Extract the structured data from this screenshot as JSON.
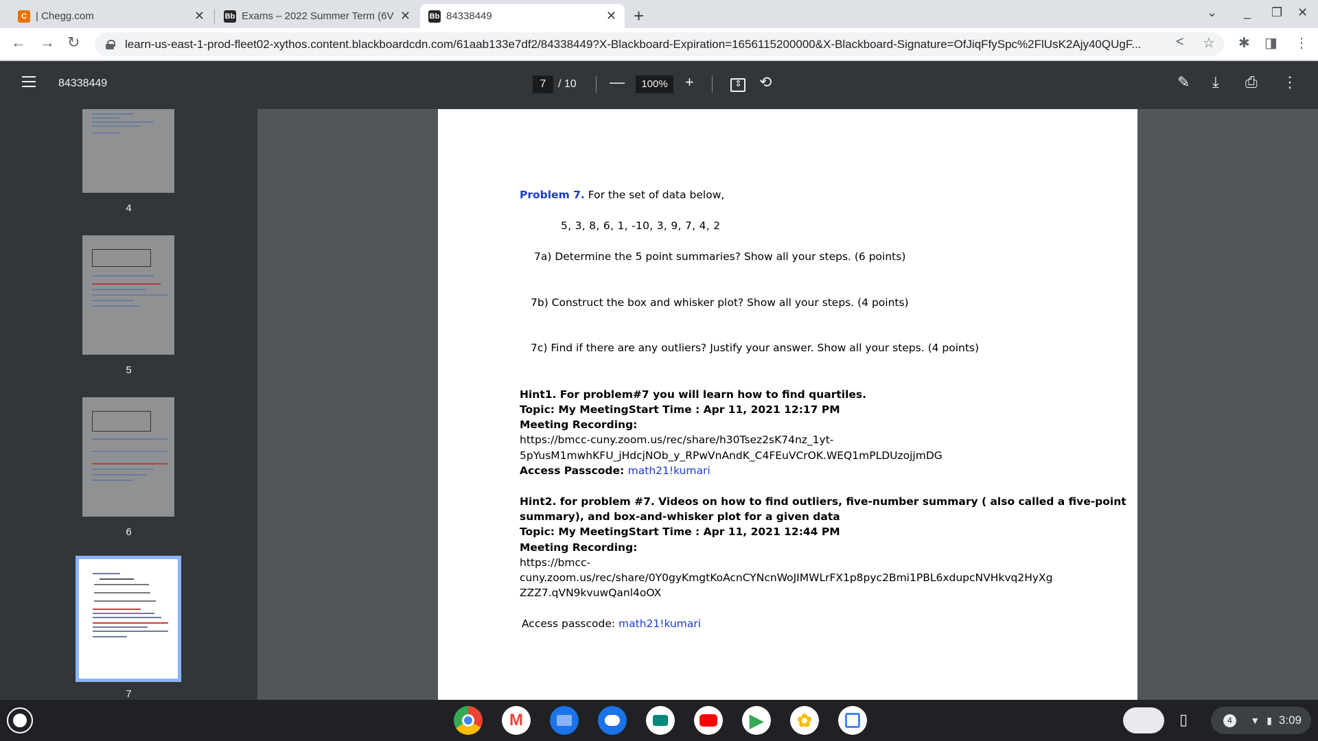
{
  "tabs": [
    {
      "label": "| Chegg.com",
      "favicon": "C"
    },
    {
      "label": "Exams – 2022 Summer Term (6V",
      "favicon": "Bb"
    },
    {
      "label": "84338449",
      "favicon": "Bb"
    }
  ],
  "address": {
    "url": "learn-us-east-1-prod-fleet02-xythos.content.blackboardcdn.com/61aab133e7df2/84338449?X-Blackboard-Expiration=1656115200000&X-Blackboard-Signature=OfJiqFfySpc%2FlUsK2Ajy40QUgF..."
  },
  "pdf": {
    "doc_name": "84338449",
    "current_page": "7",
    "total": "/ 10",
    "zoom": "100%"
  },
  "thumbnails": [
    "4",
    "5",
    "6",
    "7"
  ],
  "page": {
    "p7_label": "Problem 7.",
    "p7_text": " For the set of data below,",
    "data_values": "5,  3,  8,  6,  1,  -10,  3,  9,  7,  4,  2",
    "q7a": "7a) Determine the 5 point summaries? Show all your steps. (6 points)",
    "q7b": "7b) Construct the box and whisker plot? Show all your steps. (4 points)",
    "q7c": "7c) Find if there are any outliers? Justify your answer. Show all your steps. (4 points)",
    "hint1_title": "Hint1. For problem#7 you will learn how to find quartiles.",
    "hint1_topic": "Topic: My MeetingStart Time : Apr 11, 2021 12:17 PM",
    "hint1_rec": "Meeting Recording:",
    "hint1_link1": "https://bmcc-cuny.zoom.us/rec/share/h30Tsez2sK74nz_1yt-",
    "hint1_link2": "5pYusM1mwhKFU_jHdcjNOb_y_RPwVnAndK_C4FEuVCrOK.WEQ1mPLDUzojjmDG",
    "hint1_pass_label": "Access Passcode: ",
    "hint1_pass": "math21!kumari",
    "hint2_title1": "Hint2. for problem #7. Videos on how to find outliers, five-number summary ( also called a five-point",
    "hint2_title2": "summary), and box-and-whisker plot for a given data",
    "hint2_topic": "Topic: My MeetingStart Time : Apr 11, 2021 12:44 PM",
    "hint2_rec": "Meeting Recording:",
    "hint2_link1": "https://bmcc-",
    "hint2_link2": "cuny.zoom.us/rec/share/0Y0gyKmgtKoAcnCYNcnWoJIMWLrFX1p8pyc2Bmi1PBL6xdupcNVHkvq2HyXg",
    "hint2_link3": "ZZZ7.qVN9kvuwQanl4oOX",
    "hint2_pass_label": "Access passcode: ",
    "hint2_pass": "math21!kumari"
  },
  "shelf": {
    "notification_count": "4",
    "time": "3:09"
  }
}
